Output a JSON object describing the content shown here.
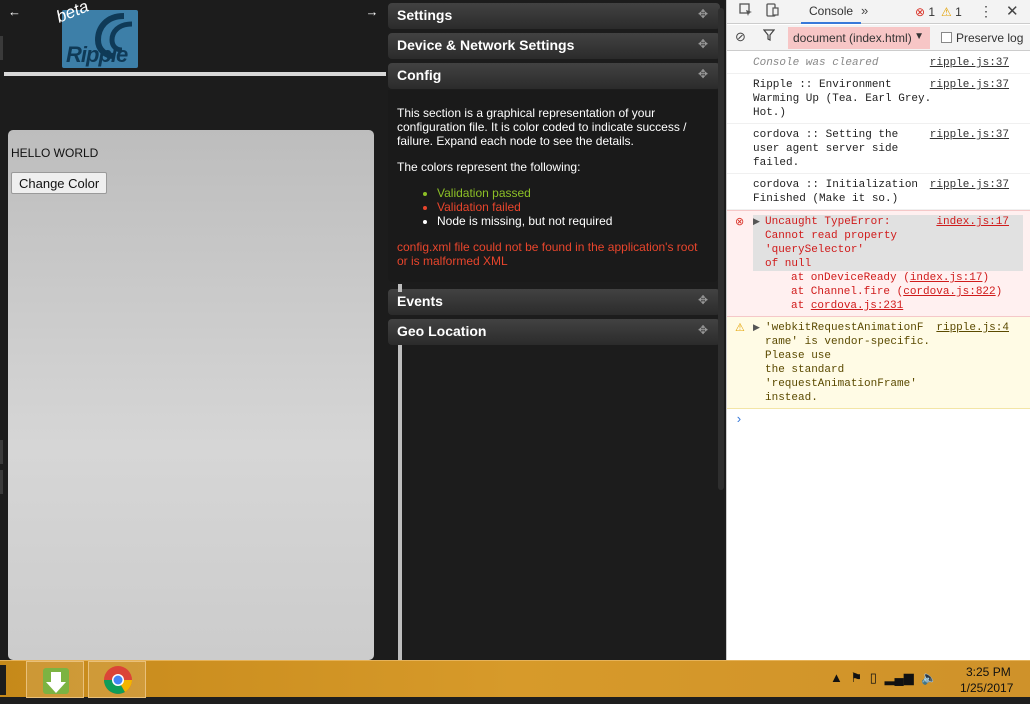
{
  "ripple": {
    "logo_text": "Ripple",
    "beta_label": "beta",
    "nav_left": "←",
    "nav_right": "→",
    "app": {
      "hello_text": "HELLO WORLD",
      "change_color_label": "Change Color"
    }
  },
  "panels": {
    "plus_glyph": "✥",
    "settings": "Settings",
    "device_network": "Device & Network Settings",
    "config": {
      "title": "Config",
      "intro": "This section is a graphical representation of your configuration file. It is color coded to indicate success / failure. Expand each node to see the details.",
      "colors_intro": "The colors represent the following:",
      "legend": {
        "pass": "Validation passed",
        "fail": "Validation failed",
        "missing": "Node is missing, but not required"
      },
      "error": "config.xml file could not be found in the application's root or is malformed XML",
      "colors": {
        "pass": "#8cbf26",
        "fail": "#e8452c",
        "missing": "#ffffff"
      }
    },
    "events": "Events",
    "geo_location": "Geo Location"
  },
  "devtools": {
    "tab_console": "Console",
    "more_tabs": "»",
    "error_count": "1",
    "warn_count": "1",
    "context": "document (index.html)",
    "preserve_log": "Preserve log",
    "messages": [
      {
        "type": "cleared",
        "text": "Console was cleared",
        "source": "ripple.js:37"
      },
      {
        "type": "log",
        "text": "Ripple :: Environment\nWarming Up (Tea. Earl Grey. Hot.)",
        "source": "ripple.js:37"
      },
      {
        "type": "log",
        "text": "cordova :: Setting the\nuser agent server side failed.",
        "source": "ripple.js:37"
      },
      {
        "type": "log",
        "text": "cordova :: Initialization\nFinished (Make it so.)",
        "source": "ripple.js:37"
      }
    ],
    "error": {
      "text": "Uncaught TypeError:\nCannot read property 'querySelector'\nof null",
      "source": "index.js:17",
      "stack": [
        {
          "prefix": "at onDeviceReady (",
          "link": "index.js:17",
          "suffix": ")"
        },
        {
          "prefix": "at Channel.fire (",
          "link": "cordova.js:822",
          "suffix": ")"
        },
        {
          "prefix": "at ",
          "link": "cordova.js:231",
          "suffix": ""
        }
      ]
    },
    "warning": {
      "text": "'webkitRequestAnimationF\nrame' is vendor-specific. Please use\nthe standard 'requestAnimationFrame'\ninstead.",
      "source": "ripple.js:4"
    },
    "prompt": "›"
  },
  "taskbar": {
    "time": "3:25 PM",
    "date": "1/25/2017"
  }
}
